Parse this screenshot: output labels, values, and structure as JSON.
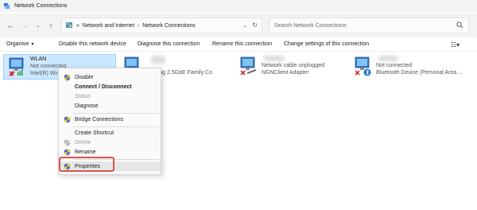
{
  "window": {
    "title": "Network Connections"
  },
  "address": {
    "overflow": "«",
    "crumbs": [
      "Network and Internet",
      "Network Connections"
    ],
    "separator": "›"
  },
  "search": {
    "placeholder": "Search Network Connections"
  },
  "toolbar": {
    "organise": "Organise",
    "disable": "Disable this network device",
    "diagnose": "Diagnose this connection",
    "rename": "Rename this connection",
    "change": "Change settings of this connection"
  },
  "connections": [
    {
      "name": "WLAN",
      "status": "Not connected",
      "device": "Intel(R) Wi-",
      "selected": true
    },
    {
      "name": "",
      "status": "",
      "device": "k Gaming 2.5GbE Family Co"
    },
    {
      "name": "",
      "status": "Network cable unplugged",
      "device": "NGNClient Adapter"
    },
    {
      "name": "",
      "status": "Not connected",
      "device": "Bluetooth Device (Personal Area ..."
    }
  ],
  "context_menu": {
    "items": [
      {
        "label": "Disable",
        "shield": true,
        "style": "normal"
      },
      {
        "label": "Connect / Disconnect",
        "shield": false,
        "style": "bold"
      },
      {
        "label": "Status",
        "shield": false,
        "style": "disabled"
      },
      {
        "label": "Diagnose",
        "shield": false,
        "style": "normal"
      },
      {
        "label": "Bridge Connections",
        "shield": true,
        "style": "normal"
      },
      {
        "label": "Create Shortcut",
        "shield": false,
        "style": "normal"
      },
      {
        "label": "Delete",
        "shield": true,
        "style": "disabled"
      },
      {
        "label": "Rename",
        "shield": true,
        "style": "normal"
      },
      {
        "label": "Properties",
        "shield": true,
        "style": "highlight"
      }
    ]
  },
  "colors": {
    "selection": "#cce8ff",
    "highlight_border": "#d9534f",
    "shield_blue": "#2b6cd4",
    "shield_yellow": "#f2c230",
    "error_red": "#d32f2f"
  }
}
